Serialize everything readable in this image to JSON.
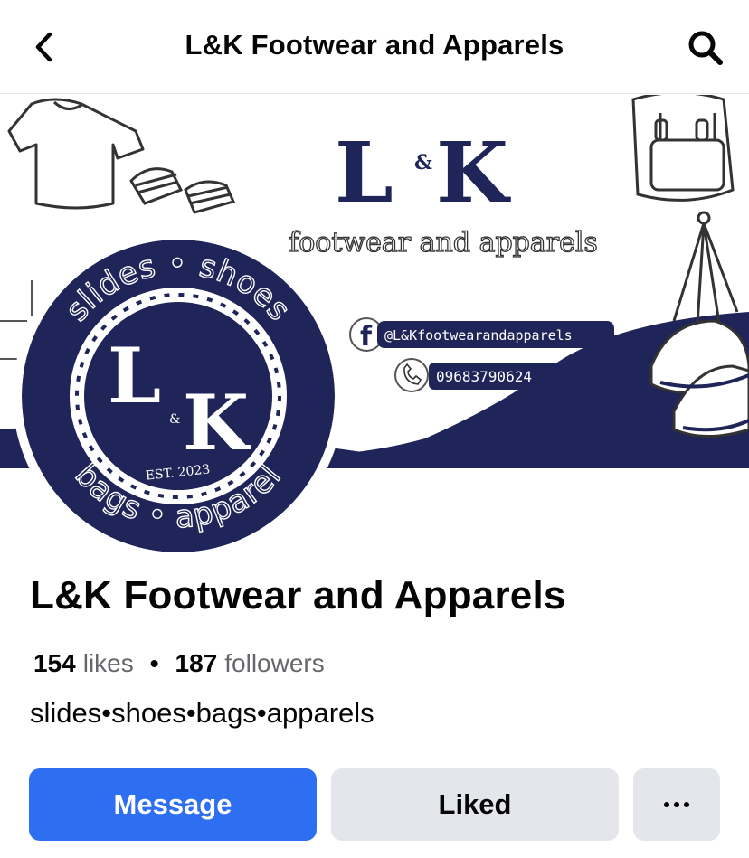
{
  "header": {
    "title": "L&K Footwear and Apparels",
    "back_icon": "chevron-left-icon",
    "search_icon": "search-icon"
  },
  "cover": {
    "logo_l": "L",
    "logo_amp": "&",
    "logo_k": "K",
    "tagline": "footwear and apparels",
    "facebook_handle": "@L&Kfootwearandapparels",
    "phone": "09683790624",
    "brand_color": "#1f2558"
  },
  "avatar": {
    "ring_top": "slides • shoes",
    "ring_bottom": "bags • apparel",
    "logo_l": "L",
    "logo_amp": "&",
    "logo_k": "K",
    "est": "EST. 2023"
  },
  "profile": {
    "name": "L&K Footwear and Apparels",
    "likes_count": "154",
    "likes_label": "likes",
    "separator": "•",
    "followers_count": "187",
    "followers_label": "followers",
    "bio": "slides•shoes•bags•apparels"
  },
  "actions": {
    "message_label": "Message",
    "liked_label": "Liked",
    "more_label": "•••",
    "message_color": "#2e6ff2",
    "secondary_color": "#e4e6eb"
  }
}
